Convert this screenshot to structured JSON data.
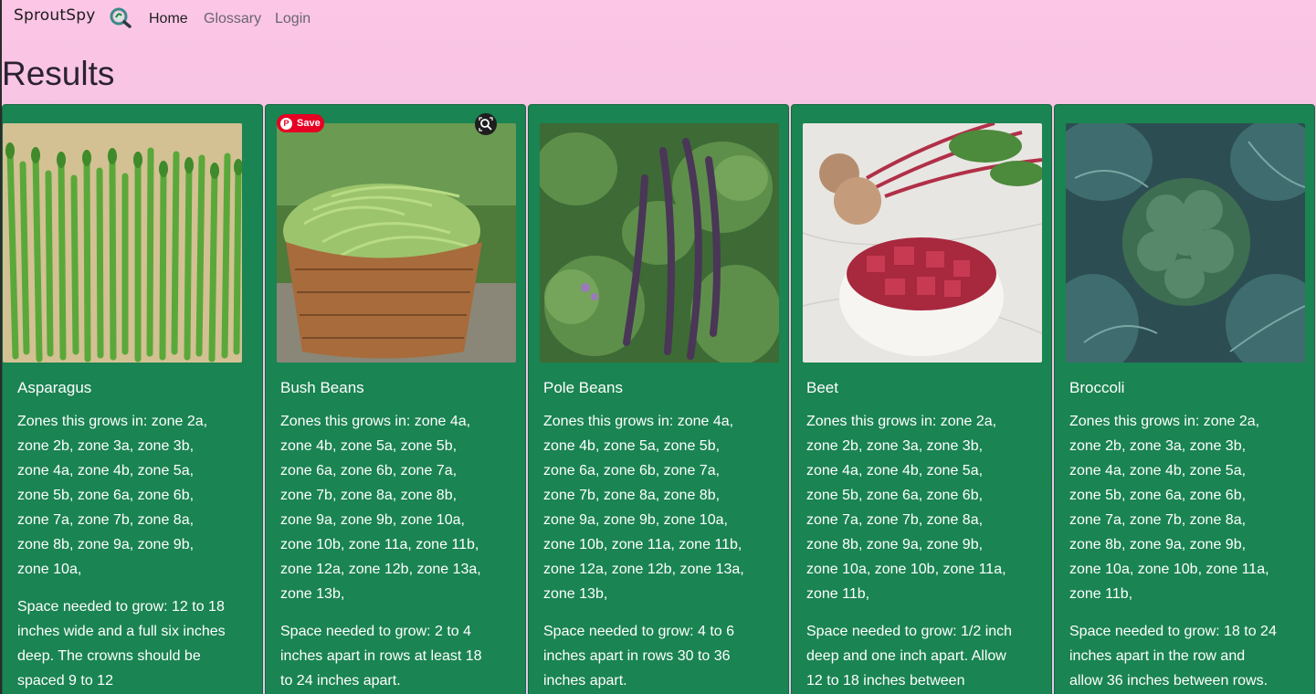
{
  "brand": {
    "name": "SproutSpy",
    "logo_icon": "magnifier-sprout-icon"
  },
  "nav": {
    "home": "Home",
    "glossary": "Glossary",
    "login": "Login"
  },
  "page": {
    "title": "Results"
  },
  "pinterest": {
    "save_label": "Save"
  },
  "cards": [
    {
      "name": "Asparagus",
      "zones": "Zones this grows in: zone 2a, zone 2b, zone 3a, zone 3b, zone 4a, zone 4b, zone 5a, zone 5b, zone 6a, zone 6b, zone 7a, zone 7b, zone 8a, zone 8b, zone 9a, zone 9b, zone 10a,",
      "space": "Space needed to grow: 12 to 18 inches wide and a full six inches deep. The crowns should be spaced 9 to 12"
    },
    {
      "name": "Bush Beans",
      "zones": "Zones this grows in: zone 4a, zone 4b, zone 5a, zone 5b, zone 6a, zone 6b, zone 7a, zone 7b, zone 8a, zone 8b, zone 9a, zone 9b, zone 10a, zone 10b, zone 11a, zone 11b, zone 12a, zone 12b, zone 13a, zone 13b,",
      "space": "Space needed to grow: 2 to 4 inches apart in rows at least 18 to 24 inches apart."
    },
    {
      "name": "Pole Beans",
      "zones": "Zones this grows in: zone 4a, zone 4b, zone 5a, zone 5b, zone 6a, zone 6b, zone 7a, zone 7b, zone 8a, zone 8b, zone 9a, zone 9b, zone 10a, zone 10b, zone 11a, zone 11b, zone 12a, zone 12b, zone 13a, zone 13b,",
      "space": "Space needed to grow: 4 to 6 inches apart in rows 30 to 36 inches apart."
    },
    {
      "name": "Beet",
      "zones": "Zones this grows in: zone 2a, zone 2b, zone 3a, zone 3b, zone 4a, zone 4b, zone 5a, zone 5b, zone 6a, zone 6b, zone 7a, zone 7b, zone 8a, zone 8b, zone 9a, zone 9b, zone 10a, zone 10b, zone 11a, zone 11b,",
      "space": "Space needed to grow: 1/2 inch deep and one inch apart. Allow 12 to 18 inches between"
    },
    {
      "name": "Broccoli",
      "zones": "Zones this grows in: zone 2a, zone 2b, zone 3a, zone 3b, zone 4a, zone 4b, zone 5a, zone 5b, zone 6a, zone 6b, zone 7a, zone 7b, zone 8a, zone 8b, zone 9a, zone 9b, zone 10a, zone 10b, zone 11a, zone 11b,",
      "space": "Space needed to grow: 18 to 24 inches apart in the row and allow 36 inches between rows."
    }
  ],
  "colors": {
    "card_bg": "#1a8452",
    "page_bg_top": "#fcc6e6",
    "page_bg_bottom": "#e2c7ec",
    "pinterest_red": "#e60023"
  }
}
